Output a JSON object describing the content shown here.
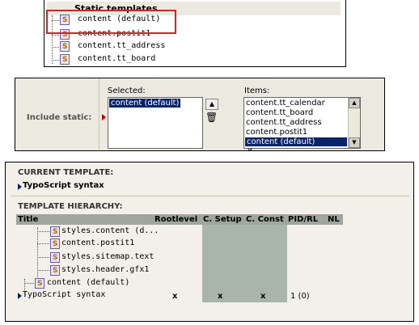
{
  "static_templates": {
    "header": "Static templates",
    "items": [
      "content (default)",
      "content.postit1",
      "content.tt_address",
      "content.tt_board"
    ]
  },
  "include_static": {
    "label": "Include static:",
    "selected_label": "Selected:",
    "items_label": "Items:",
    "selected_items": [
      "content (default)"
    ],
    "available_items": [
      "content.tt_calendar",
      "content.tt_board",
      "content.tt_address",
      "content.postit1",
      "content (default)"
    ],
    "available_selected_index": 4,
    "partial_item": "d"
  },
  "template_panel": {
    "current_template_label": "CURRENT TEMPLATE:",
    "current_template_name": "TypoScript syntax",
    "hierarchy_label": "TEMPLATE HIERARCHY:",
    "columns": [
      "Title",
      "Rootlevel",
      "C. Setup",
      "C. Const",
      "PID/RL",
      "NL"
    ],
    "rows": [
      {
        "title": "styles.content (d..."
      },
      {
        "title": "content.postit1"
      },
      {
        "title": "styles.sitemap.text"
      },
      {
        "title": "styles.header.gfx1"
      },
      {
        "title": "content (default)"
      },
      {
        "title": "TypoScript syntax",
        "rootlevel": "x",
        "setup": "x",
        "const": "x",
        "pid": "1 (0)"
      }
    ]
  },
  "colors": {
    "highlight_border": "#e02020",
    "selection": "#0a246a",
    "table_header": "#9fa59f",
    "grey_column": "#a9b4ab"
  }
}
